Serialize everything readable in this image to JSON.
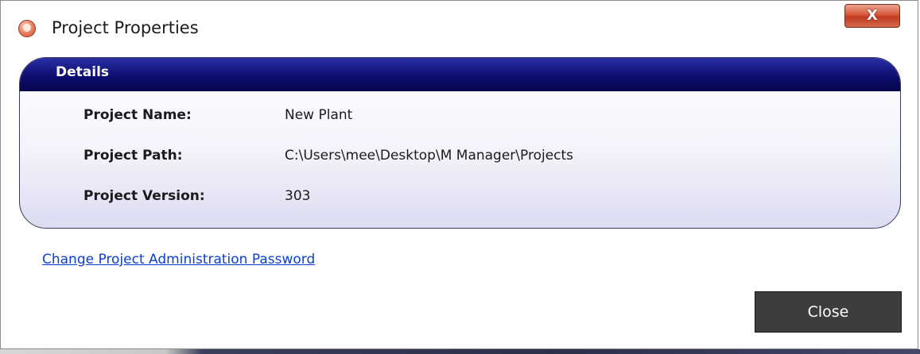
{
  "window": {
    "title": "Project Properties",
    "close_glyph": "X"
  },
  "details": {
    "header": "Details",
    "fields": [
      {
        "label": "Project Name:",
        "value": "New Plant"
      },
      {
        "label": "Project Path:",
        "value": "C:\\Users\\mee\\Desktop\\M Manager\\Projects"
      },
      {
        "label": "Project Version:",
        "value": "303"
      }
    ]
  },
  "link": {
    "label": "Change Project Administration Password"
  },
  "buttons": {
    "close_label": "Close"
  },
  "colors": {
    "header_dark": "#05054e",
    "header_light": "#2a2fa6",
    "link": "#0a3fd1",
    "close_button": "#3d3d3d",
    "title_close": "#c13a1f"
  },
  "icons": {
    "app": "project-shield-icon",
    "window_close": "close-icon"
  }
}
